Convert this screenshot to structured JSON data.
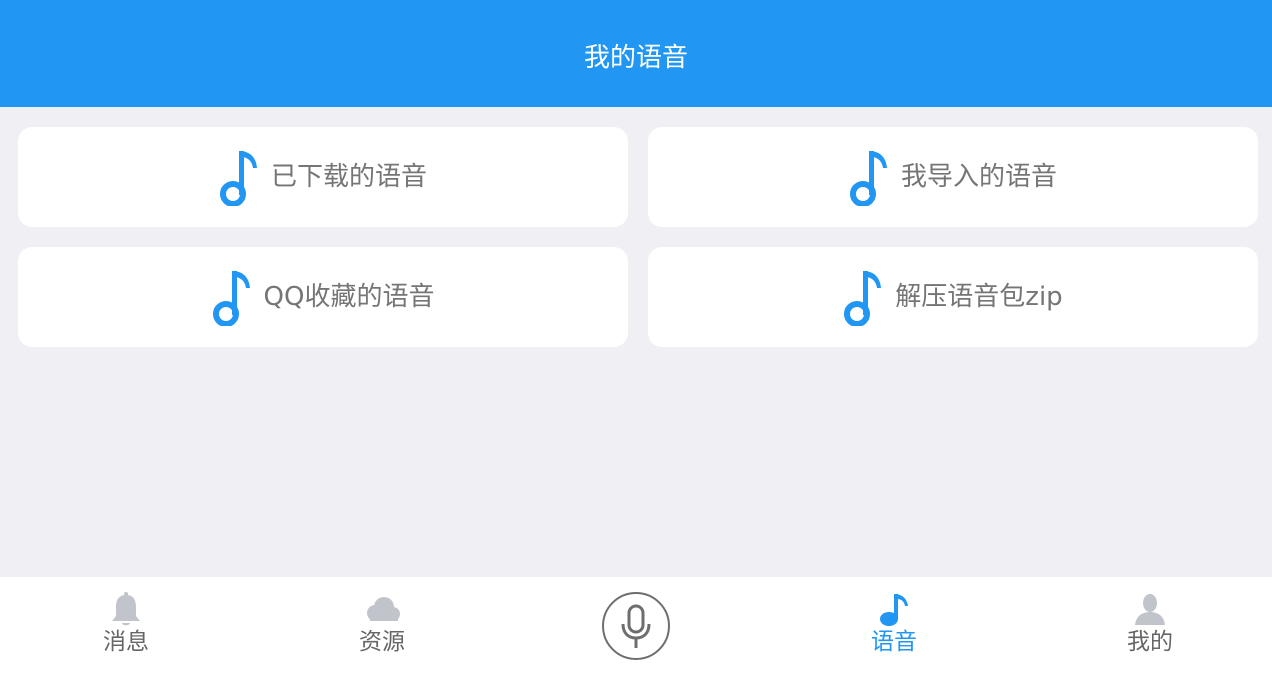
{
  "header": {
    "title": "我的语音"
  },
  "cards": [
    {
      "label": "已下载的语音",
      "icon": "music-note-icon"
    },
    {
      "label": "我导入的语音",
      "icon": "music-note-icon"
    },
    {
      "label": "QQ收藏的语音",
      "icon": "music-note-icon"
    },
    {
      "label": "解压语音包zip",
      "icon": "music-note-icon"
    }
  ],
  "bottom_nav": {
    "tabs": [
      {
        "label": "消息",
        "icon": "bell-icon",
        "active": false
      },
      {
        "label": "资源",
        "icon": "cloud-icon",
        "active": false
      },
      {
        "label": "语音",
        "icon": "music-note-icon",
        "active": true
      },
      {
        "label": "我的",
        "icon": "person-icon",
        "active": false
      }
    ],
    "center_icon": "microphone-icon"
  },
  "colors": {
    "accent": "#2196f3",
    "background": "#efeff4",
    "card": "#ffffff",
    "text_gray": "#757575",
    "inactive_icon": "#c2c4cc"
  }
}
